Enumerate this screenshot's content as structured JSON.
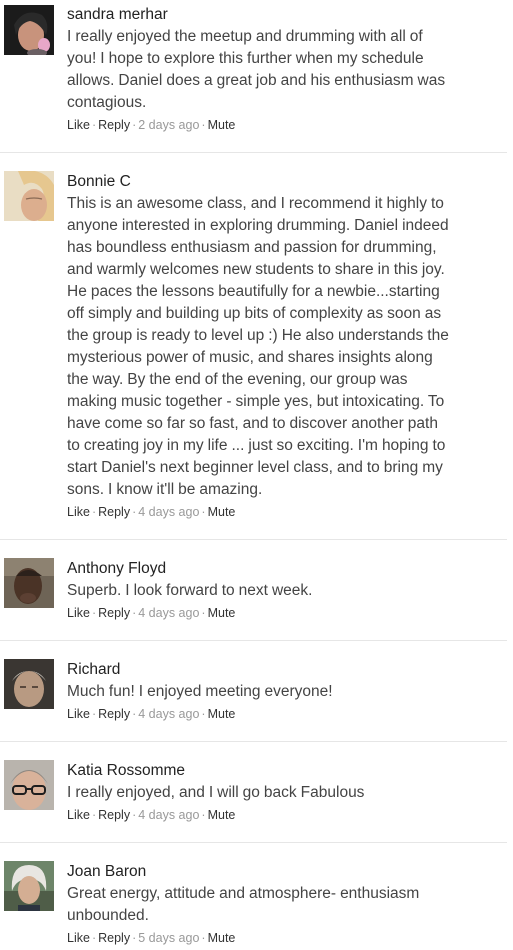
{
  "comments": [
    {
      "author": "sandra merhar",
      "avatar_icon": "user-photo-icon",
      "lines": [
        "I really enjoyed the meetup and drumming with all of",
        "you! I hope to explore this further when my schedule",
        "allows. Daniel does a great job and his enthusiasm was",
        "contagious."
      ],
      "actions": {
        "like": "Like",
        "reply": "Reply",
        "time": "2 days ago",
        "mute": "Mute"
      }
    },
    {
      "author": "Bonnie C",
      "avatar_icon": "user-photo-icon",
      "lines": [
        "This is an awesome class, and I recommend it highly to",
        "anyone interested in exploring drumming. Daniel indeed",
        "has boundless enthusiasm and passion for drumming,",
        "and warmly welcomes new students to share in this joy.",
        "He paces the lessons beautifully for a newbie...starting",
        "off simply and building up bits of complexity as soon as",
        "the group is ready to level up :) He also understands the",
        "mysterious power of music, and shares insights along",
        "the way. By the end of the evening, our group was",
        "making music together - simple yes, but intoxicating. To",
        "have come so far so fast, and to discover another path",
        "to creating joy in my life ... just so exciting. I'm hoping to",
        "start Daniel's next beginner level class, and to bring my",
        "sons. I know it'll be amazing."
      ],
      "actions": {
        "like": "Like",
        "reply": "Reply",
        "time": "4 days ago",
        "mute": "Mute"
      }
    },
    {
      "author": "Anthony Floyd",
      "avatar_icon": "user-photo-icon",
      "lines": [
        "Superb. I look forward to next week."
      ],
      "actions": {
        "like": "Like",
        "reply": "Reply",
        "time": "4 days ago",
        "mute": "Mute"
      }
    },
    {
      "author": "Richard",
      "avatar_icon": "user-photo-icon",
      "lines": [
        "Much fun! I enjoyed meeting everyone!"
      ],
      "actions": {
        "like": "Like",
        "reply": "Reply",
        "time": "4 days ago",
        "mute": "Mute"
      }
    },
    {
      "author": "Katia Rossomme",
      "avatar_icon": "user-photo-icon",
      "lines": [
        "I really enjoyed, and I will go back Fabulous"
      ],
      "actions": {
        "like": "Like",
        "reply": "Reply",
        "time": "4 days ago",
        "mute": "Mute"
      }
    },
    {
      "author": "Joan Baron",
      "avatar_icon": "user-photo-icon",
      "lines": [
        "Great energy, attitude and atmosphere- enthusiasm",
        "unbounded."
      ],
      "actions": {
        "like": "Like",
        "reply": "Reply",
        "time": "5 days ago",
        "mute": "Mute"
      }
    }
  ],
  "colors": {
    "text": "#444444",
    "author": "#222222",
    "meta": "#999999",
    "divider": "#e6e6e6"
  }
}
